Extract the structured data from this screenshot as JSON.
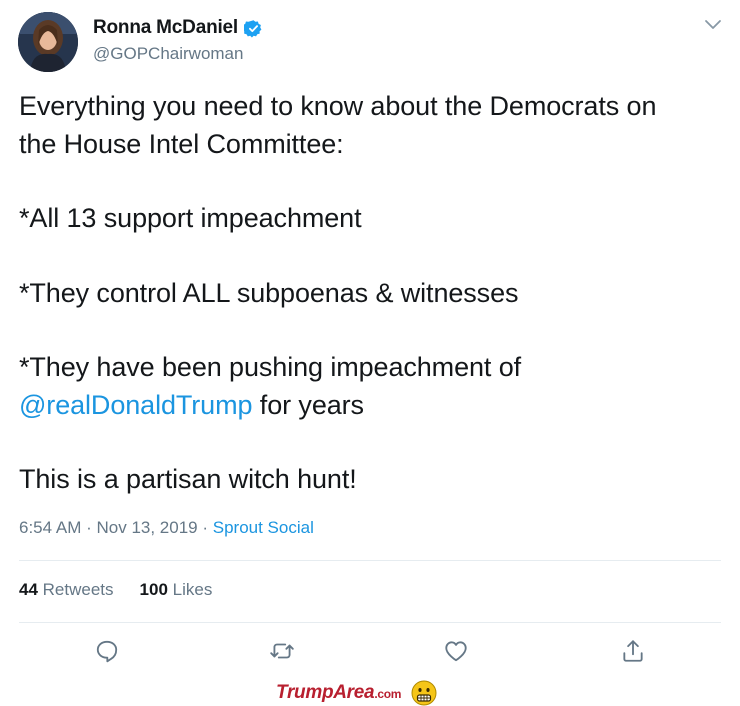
{
  "author": {
    "name": "Ronna McDaniel",
    "handle": "@GOPChairwoman"
  },
  "tweet": {
    "line1": "Everything you need to know about the Democrats on",
    "line2": "the House Intel Committee:",
    "line3": "*All 13 support impeachment",
    "line4": "*They control ALL subpoenas & witnesses",
    "line5": "*They have been pushing impeachment of",
    "mention": "@realDonaldTrump",
    "line6_rest": " for years",
    "line7": "This is a partisan witch hunt!"
  },
  "meta": {
    "time": "6:54 AM",
    "sep1": " · ",
    "date": "Nov 13, 2019",
    "sep2": " · ",
    "source": "Sprout Social"
  },
  "stats": {
    "retweets_count": "44",
    "retweets_label": "Retweets",
    "likes_count": "100",
    "likes_label": "Likes"
  },
  "icons": {
    "reply": "reply-icon",
    "retweet": "retweet-icon",
    "like": "heart-icon",
    "share": "share-icon",
    "more": "chevron-down-icon",
    "verified": "verified-badge-icon"
  },
  "colors": {
    "link": "#1b95e0",
    "secondary_text": "#657786",
    "primary_text": "#14171a",
    "verified": "#1da1f2",
    "watermark": "#b81f2f"
  },
  "watermark": {
    "brand": "TrumpArea",
    "suffix": ".com"
  }
}
